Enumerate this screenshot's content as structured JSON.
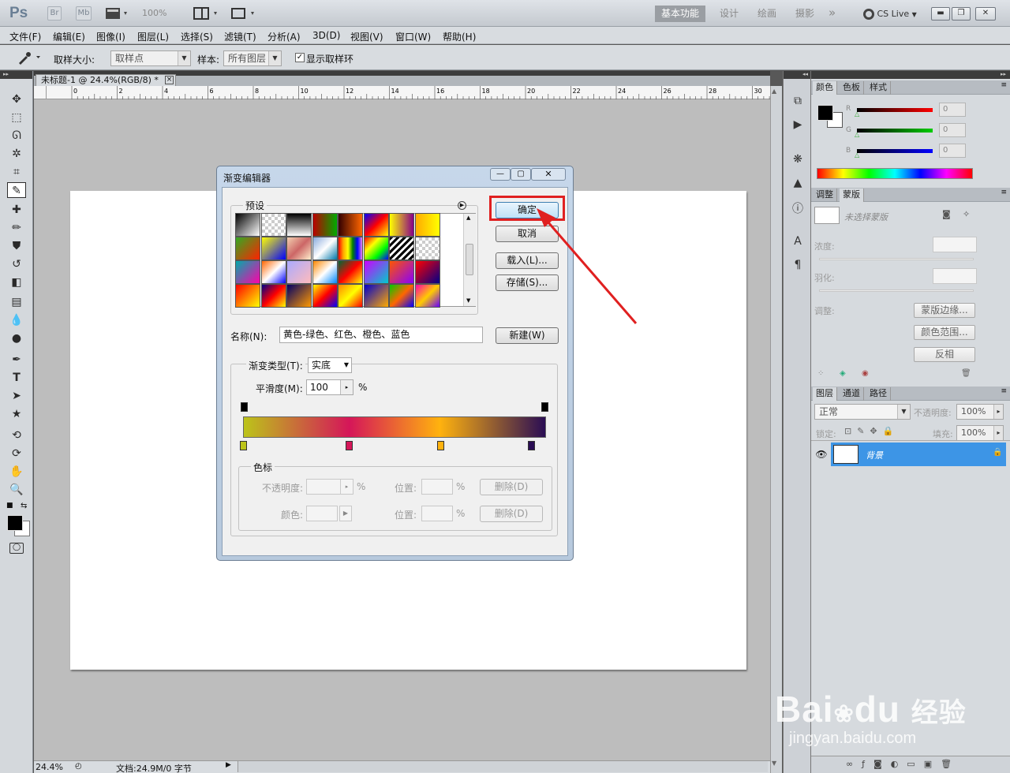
{
  "app": {
    "logo": "Ps"
  },
  "topbar": {
    "buttons": [
      "Br",
      "Mb",
      "100%"
    ],
    "workspaces": [
      "基本功能",
      "设计",
      "绘画",
      "摄影"
    ],
    "more": "»",
    "cslive": "CS Live"
  },
  "menu": [
    "文件(F)",
    "编辑(E)",
    "图像(I)",
    "图层(L)",
    "选择(S)",
    "滤镜(T)",
    "分析(A)",
    "3D(D)",
    "视图(V)",
    "窗口(W)",
    "帮助(H)"
  ],
  "options": {
    "sample_size_label": "取样大小:",
    "sample_size_value": "取样点",
    "sample_label": "样本:",
    "sample_value": "所有图层",
    "show_ring_label": "显示取样环"
  },
  "document": {
    "tab_title": "未标题-1 @ 24.4%(RGB/8) *",
    "ruler_h": [
      "0",
      "2",
      "4",
      "6",
      "8",
      "10",
      "12",
      "14",
      "16",
      "18",
      "20",
      "22",
      "24",
      "26",
      "28",
      "30"
    ],
    "ruler_v": [
      "0",
      "2",
      "4",
      "6",
      "8",
      "10",
      "12",
      "14",
      "16",
      "18",
      "20"
    ],
    "zoom": "24.4%",
    "doc_info": "文档:24.9M/0 字节"
  },
  "panels": {
    "color_tabs": [
      "颜色",
      "色板",
      "样式"
    ],
    "rgb_labels": [
      "R",
      "G",
      "B"
    ],
    "rgb_values": [
      "0",
      "0",
      "0"
    ],
    "adjust_tabs": [
      "调整",
      "蒙版"
    ],
    "mask_status": "未选择蒙版",
    "density_label": "浓度:",
    "feather_label": "羽化:",
    "refine_label": "调整:",
    "mask_edge": "蒙版边缘...",
    "color_range": "颜色范围...",
    "invert": "反相",
    "layers_tabs": [
      "图层",
      "通道",
      "路径"
    ],
    "blend_mode": "正常",
    "opacity_label": "不透明度:",
    "opacity_value": "100%",
    "lock_label": "锁定:",
    "fill_label": "填充:",
    "fill_value": "100%",
    "layer_name": "背景"
  },
  "dialog": {
    "title": "渐变编辑器",
    "presets_label": "预设",
    "ok": "确定",
    "cancel": "取消",
    "load": "载入(L)...",
    "save": "存储(S)...",
    "name_label": "名称(N):",
    "name_value": "黄色-绿色、红色、橙色、蓝色",
    "new": "新建(W)",
    "type_label": "渐变类型(T):",
    "type_value": "实底",
    "smooth_label": "平滑度(M):",
    "smooth_value": "100",
    "percent": "%",
    "stops_label": "色标",
    "opacity_label": "不透明度:",
    "location_label": "位置:",
    "color_label": "颜色:",
    "delete": "删除(D)"
  },
  "watermark": {
    "brand": "Bai",
    "brand2": "du",
    "cn": "经验",
    "url": "jingyan.baidu.com"
  },
  "colors": {
    "highlight": "#e02020",
    "layer_selected": "#3d95e6",
    "gradient": [
      "#bcc41a",
      "#d51659",
      "#ffb20e",
      "#2a0d54"
    ]
  }
}
